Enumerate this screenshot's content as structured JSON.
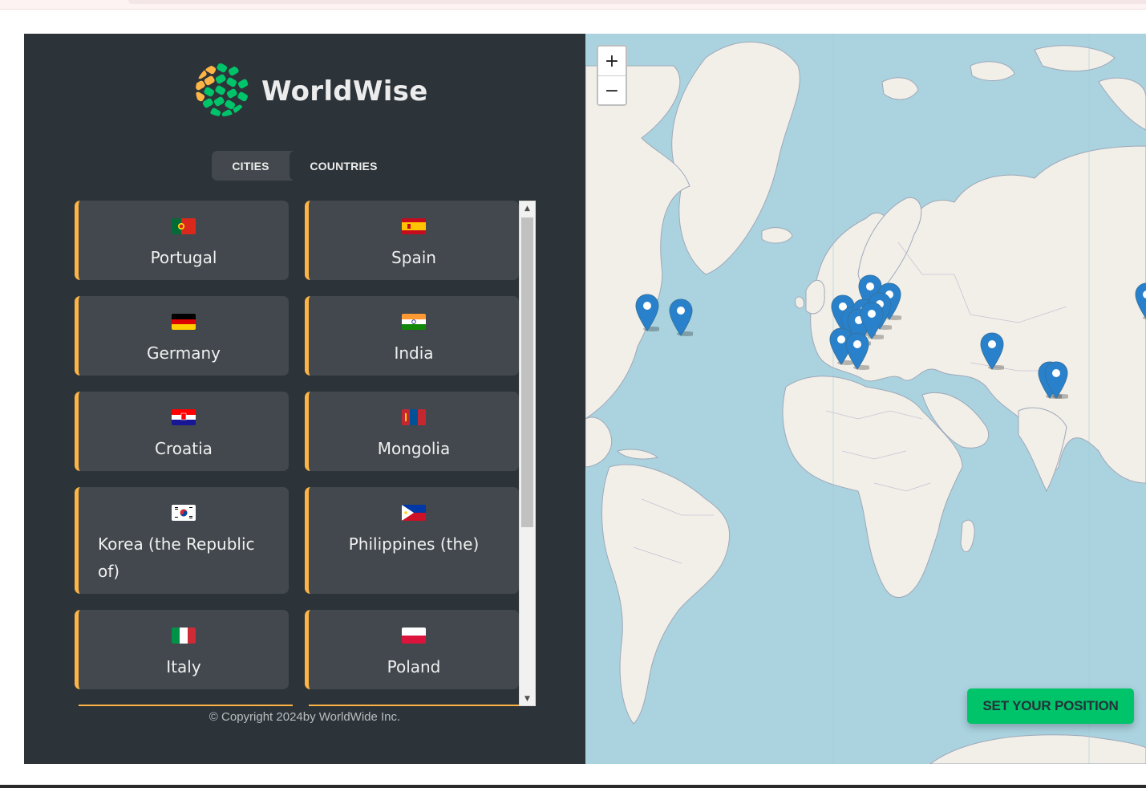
{
  "app": {
    "name": "WorldWise"
  },
  "tabs": {
    "cities": "CITIES",
    "countries": "COUNTRIES",
    "active": "countries"
  },
  "countries": [
    {
      "name": "Portugal",
      "flag": "portugal-flag-icon"
    },
    {
      "name": "Spain",
      "flag": "spain-flag-icon"
    },
    {
      "name": "Germany",
      "flag": "germany-flag-icon"
    },
    {
      "name": "India",
      "flag": "india-flag-icon"
    },
    {
      "name": "Croatia",
      "flag": "croatia-flag-icon"
    },
    {
      "name": "Mongolia",
      "flag": "mongolia-flag-icon"
    },
    {
      "name": "Korea (the Republic of)",
      "flag": "south-korea-flag-icon"
    },
    {
      "name": "Philippines (the)",
      "flag": "philippines-flag-icon"
    },
    {
      "name": "Italy",
      "flag": "italy-flag-icon"
    },
    {
      "name": "Poland",
      "flag": "poland-flag-icon"
    }
  ],
  "footer": {
    "copyright": "© Copyright 2024by WorldWide Inc."
  },
  "map": {
    "zoom_in": "+",
    "zoom_out": "−",
    "set_position": "SET YOUR POSITION",
    "marker_count": 16
  },
  "colors": {
    "sidebar_bg": "#2d3439",
    "card_bg": "#42484d",
    "card_accent": "#ffb545",
    "brand_green": "#00c46a",
    "map_water": "#aad3df",
    "map_land": "#f2efe9",
    "marker": "#2a81cb"
  }
}
